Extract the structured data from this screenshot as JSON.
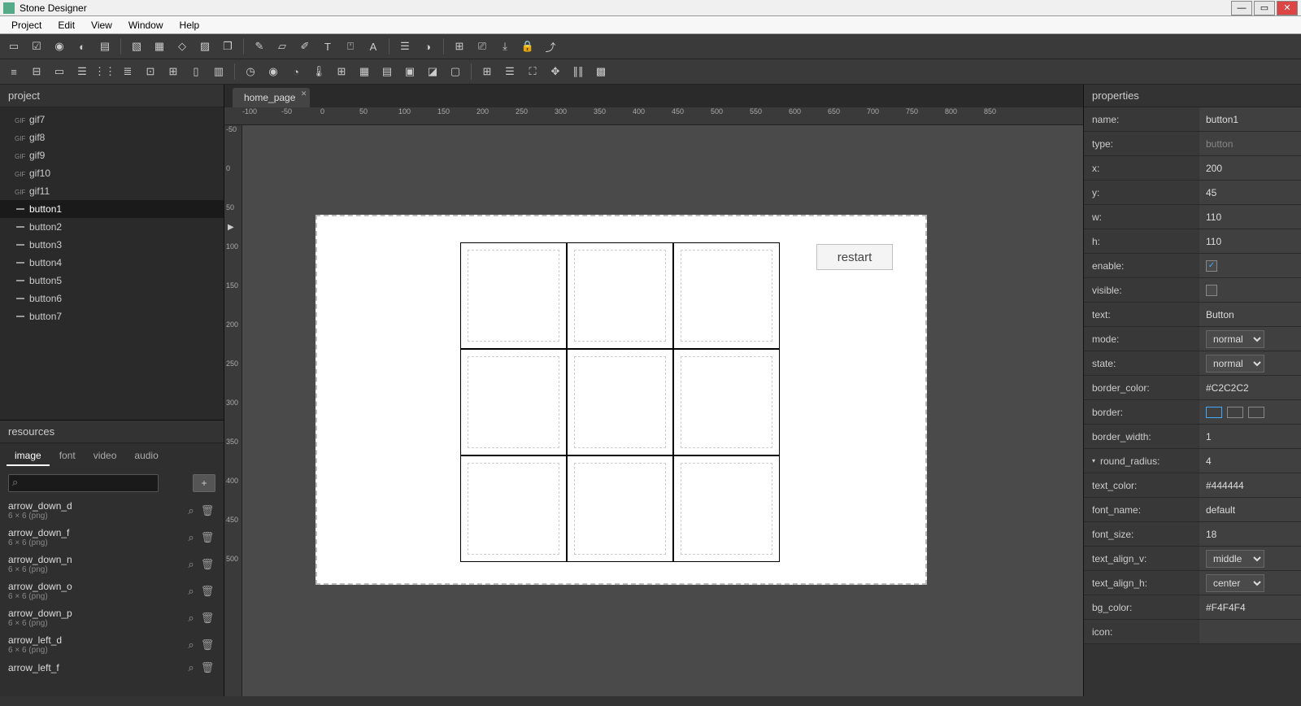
{
  "app_title": "Stone Designer",
  "menus": [
    "Project",
    "Edit",
    "View",
    "Window",
    "Help"
  ],
  "left": {
    "project_header": "project",
    "tree": [
      {
        "label": "gif7",
        "kind": "gif"
      },
      {
        "label": "gif8",
        "kind": "gif"
      },
      {
        "label": "gif9",
        "kind": "gif"
      },
      {
        "label": "gif10",
        "kind": "gif"
      },
      {
        "label": "gif11",
        "kind": "gif"
      },
      {
        "label": "button1",
        "kind": "btn",
        "selected": true
      },
      {
        "label": "button2",
        "kind": "btn"
      },
      {
        "label": "button3",
        "kind": "btn"
      },
      {
        "label": "button4",
        "kind": "btn"
      },
      {
        "label": "button5",
        "kind": "btn"
      },
      {
        "label": "button6",
        "kind": "btn"
      },
      {
        "label": "button7",
        "kind": "btn"
      }
    ],
    "resources_header": "resources",
    "res_tabs": [
      "image",
      "font",
      "video",
      "audio"
    ],
    "res_tab_active": "image",
    "res_add": "+",
    "resources": [
      {
        "name": "arrow_down_d",
        "meta": "6 × 6 (png)"
      },
      {
        "name": "arrow_down_f",
        "meta": "6 × 6 (png)"
      },
      {
        "name": "arrow_down_n",
        "meta": "6 × 6 (png)"
      },
      {
        "name": "arrow_down_o",
        "meta": "6 × 6 (png)"
      },
      {
        "name": "arrow_down_p",
        "meta": "6 × 6 (png)"
      },
      {
        "name": "arrow_left_d",
        "meta": "6 × 6 (png)"
      },
      {
        "name": "arrow_left_f",
        "meta": ""
      }
    ]
  },
  "center": {
    "tab_name": "home_page",
    "ruler_h": [
      "-100",
      "-50",
      "0",
      "50",
      "100",
      "150",
      "200",
      "250",
      "300",
      "350",
      "400",
      "450",
      "500",
      "550",
      "600",
      "650",
      "700",
      "750",
      "800",
      "850"
    ],
    "ruler_v": [
      "-50",
      "0",
      "50",
      "100",
      "150",
      "200",
      "250",
      "300",
      "350",
      "400",
      "450",
      "500"
    ],
    "restart_label": "restart"
  },
  "right": {
    "header": "properties",
    "props": [
      {
        "label": "name:",
        "value": "button1",
        "type": "text"
      },
      {
        "label": "type:",
        "value": "button",
        "type": "readonly"
      },
      {
        "label": "x:",
        "value": "200",
        "type": "text"
      },
      {
        "label": "y:",
        "value": "45",
        "type": "text"
      },
      {
        "label": "w:",
        "value": "110",
        "type": "text"
      },
      {
        "label": "h:",
        "value": "110",
        "type": "text"
      },
      {
        "label": "enable:",
        "value": "checked",
        "type": "check"
      },
      {
        "label": "visible:",
        "value": "",
        "type": "check"
      },
      {
        "label": "text:",
        "value": "Button",
        "type": "text"
      },
      {
        "label": "mode:",
        "value": "normal",
        "type": "select"
      },
      {
        "label": "state:",
        "value": "normal",
        "type": "select"
      },
      {
        "label": "border_color:",
        "value": "#C2C2C2",
        "type": "text"
      },
      {
        "label": "border:",
        "value": "",
        "type": "swatches"
      },
      {
        "label": "border_width:",
        "value": "1",
        "type": "text"
      },
      {
        "label": "round_radius:",
        "value": "4",
        "type": "text",
        "chev": true
      },
      {
        "label": "text_color:",
        "value": "#444444",
        "type": "text"
      },
      {
        "label": "font_name:",
        "value": "default",
        "type": "text"
      },
      {
        "label": "font_size:",
        "value": "18",
        "type": "text"
      },
      {
        "label": "text_align_v:",
        "value": "middle",
        "type": "select"
      },
      {
        "label": "text_align_h:",
        "value": "center",
        "type": "select"
      },
      {
        "label": "bg_color:",
        "value": "#F4F4F4",
        "type": "text"
      },
      {
        "label": "icon:",
        "value": "",
        "type": "text"
      }
    ]
  }
}
